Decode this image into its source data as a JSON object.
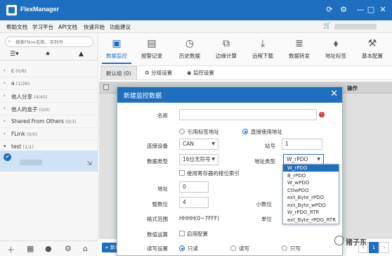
{
  "app": {
    "title": "FlexManager"
  },
  "menu": [
    "帮助文档",
    "学习平台",
    "API文档",
    "快速开始",
    "功能建议"
  ],
  "sidebar": {
    "search_placeholder": "搜索FBox名称、序列号",
    "groups": [
      {
        "label": "c",
        "count": "(0/8)"
      },
      {
        "label": "a",
        "count": "(1/26)"
      },
      {
        "label": "他人分享",
        "count": "(4/45)"
      },
      {
        "label": "他人的盒子",
        "count": "(0/0)"
      },
      {
        "label": "Shared From Others",
        "count": "(0/3)"
      },
      {
        "label": "FLink",
        "count": "(0/0)"
      },
      {
        "label": "test",
        "count": "(1/1)"
      }
    ]
  },
  "toolbar": {
    "items": [
      "数据监控",
      "报警记录",
      "历史数据",
      "边缘计算",
      "远程下载",
      "数据转发",
      "地址标签",
      "基本配置"
    ],
    "active_index": 0
  },
  "subtabs": [
    "默认组 (0)",
    "分组设置",
    "监控设置"
  ],
  "table": {
    "op_header": "操作"
  },
  "bottom": {
    "new_label": "+ 新增",
    "page": "1"
  },
  "watermark": "猪子东",
  "modal": {
    "title": "新建监控数据",
    "fields": {
      "name_label": "名称",
      "name_value": "",
      "radio_ref": "引用标签地址",
      "radio_direct": "直接使用地址",
      "device_label": "连接设备",
      "device_value": "CAN",
      "station_label": "站号",
      "station_value": "1",
      "dtype_label": "数据类型",
      "dtype_value": "16位无符号",
      "addrtype_label": "地址类型",
      "addrtype_value": "W_rPDO",
      "use_reg_bit": "使用寄存器的按位索引",
      "addr_label": "地址",
      "addr_value": "0",
      "int_label": "整数位",
      "int_value": "4",
      "decimal_label": "小数位",
      "format_label": "格式范围",
      "format_value": "HHHH(0~7FFF)",
      "unit_label": "单位",
      "calc_label": "数值运算",
      "calc_check": "启用配置",
      "rw_label": "读写设置",
      "rw_ro": "只读",
      "rw_rw": "读写",
      "rw_wo": "只写"
    },
    "dropdown": [
      "W_rPDO",
      "B_rPDO",
      "W_wPDO",
      "CtlwPDO",
      "ext_Byte_rPDO",
      "ext_Byte_wPDO",
      "W_rPDO_RTR",
      "ext_Byte_rPDO_RTR"
    ],
    "dropdown_selected": 0
  }
}
